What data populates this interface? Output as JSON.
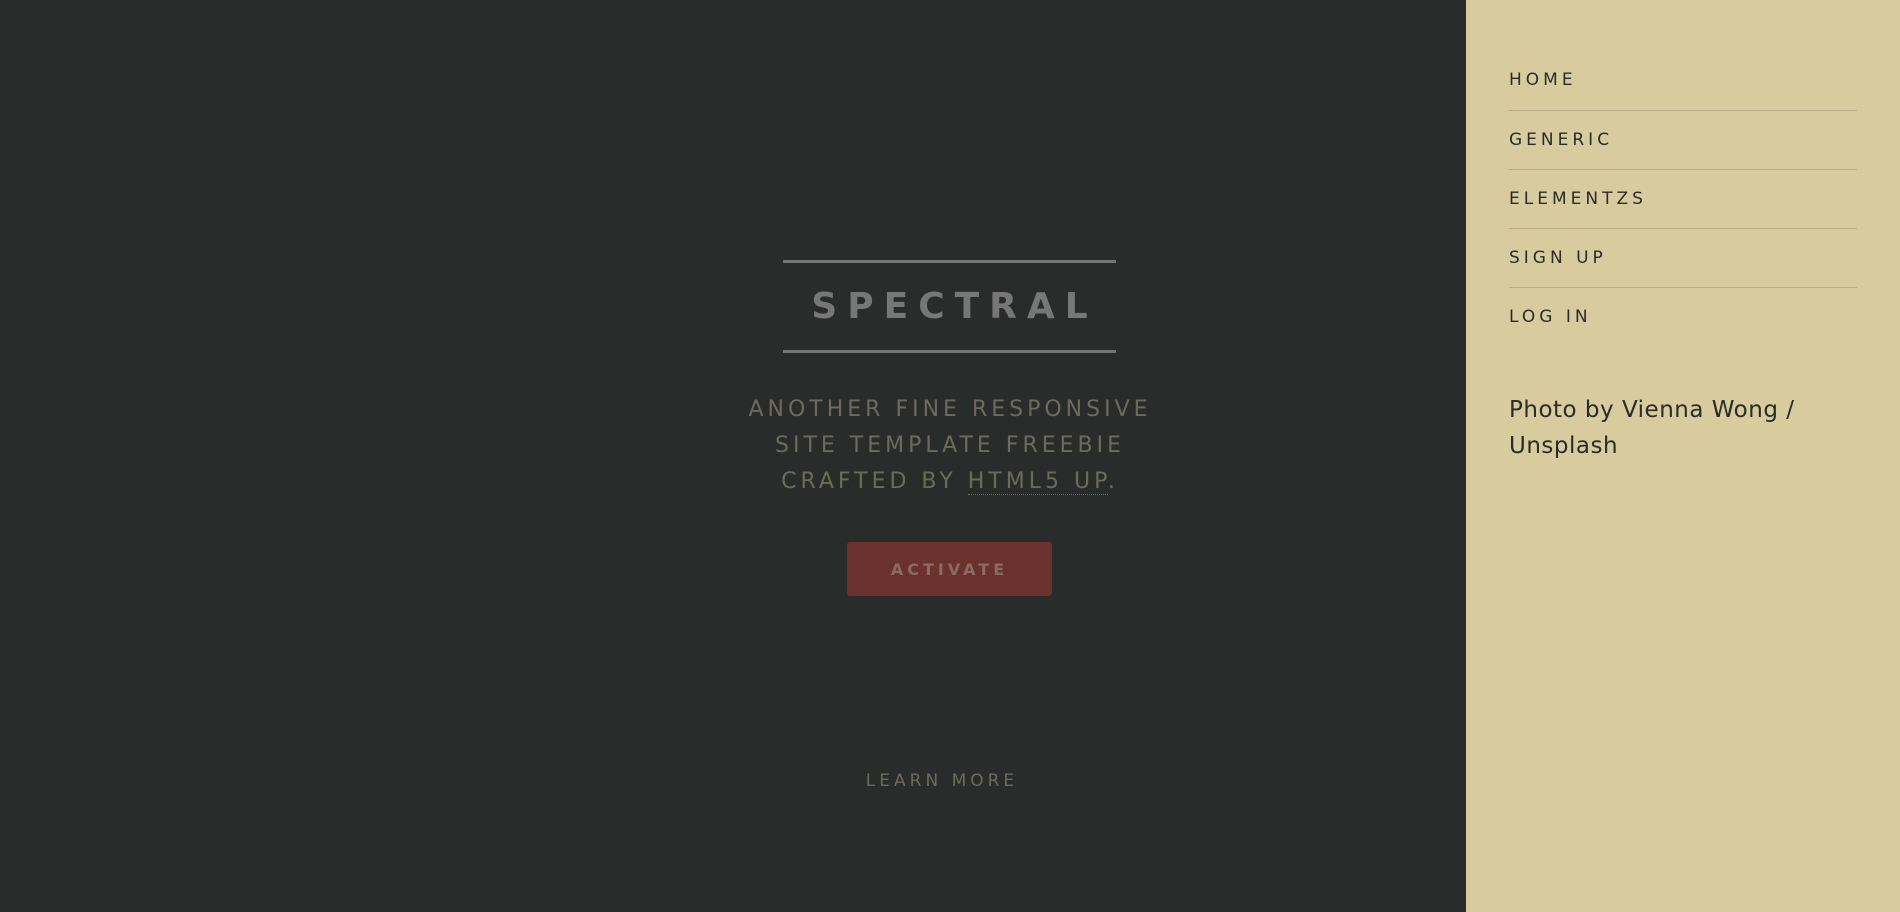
{
  "hero": {
    "title": "SPECTRAL",
    "tagline_line1": "ANOTHER FINE RESPONSIVE",
    "tagline_line2": "SITE TEMPLATE FREEBIE",
    "tagline_line3_prefix": "CRAFTED BY ",
    "tagline_link": "HTML5 UP",
    "tagline_suffix": ".",
    "activate_label": "ACTIVATE",
    "learn_more_label": "LEARN MORE"
  },
  "sidebar": {
    "nav": [
      {
        "label": "HOME"
      },
      {
        "label": "GENERIC"
      },
      {
        "label": "ELEMENTZS"
      },
      {
        "label": "SIGN UP"
      },
      {
        "label": "LOG IN"
      }
    ],
    "credit": "Photo by Vienna Wong / Unsplash"
  },
  "colors": {
    "background": "#2a2c2b",
    "sidebar": "#d8cb9d",
    "accent_button": "#6b312d",
    "title_text": "#777777",
    "muted_text": "#6d6a5d"
  }
}
